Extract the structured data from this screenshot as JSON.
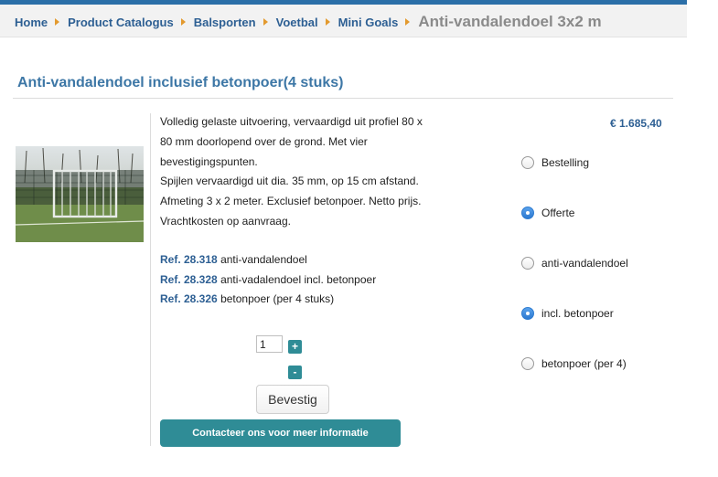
{
  "breadcrumb": {
    "items": [
      "Home",
      "Product Catalogus",
      "Balsporten",
      "Voetbal",
      "Mini Goals"
    ],
    "current": "Anti-vandalendoel 3x2 m"
  },
  "product": {
    "title": "Anti-vandalendoel inclusief betonpoer(4 stuks)",
    "description_lines": [
      "Volledig gelaste uitvoering, vervaardigd uit profiel 80 x",
      "80 mm doorlopend over de grond. Met vier",
      "bevestigingspunten.",
      "Spijlen vervaardigd uit dia. 35 mm, op 15 cm afstand.",
      "Afmeting 3 x 2 meter. Exclusief betonpoer. Netto prijs.",
      "Vrachtkosten op aanvraag."
    ],
    "refs": [
      {
        "label": "Ref. 28.318",
        "text": "anti-vandalendoel"
      },
      {
        "label": "Ref. 28.328",
        "text": "anti-vadalendoel incl. betonpoer"
      },
      {
        "label": "Ref. 28.326",
        "text": "betonpoer (per 4 stuks)"
      }
    ],
    "price": "€ 1.685,40",
    "image_icon": "football-goal-photo"
  },
  "options": [
    {
      "label": "Bestelling",
      "checked": false
    },
    {
      "label": "Offerte",
      "checked": true
    },
    {
      "label": "anti-vandalendoel",
      "checked": false
    },
    {
      "label": "incl. betonpoer",
      "checked": true
    },
    {
      "label": "betonpoer (per 4)",
      "checked": false
    }
  ],
  "quantity": {
    "value": "1",
    "plus_label": "+",
    "minus_label": "-"
  },
  "buttons": {
    "confirm_label": "Bevestig",
    "contact_label": "Contacteer ons voor meer informatie"
  },
  "colors": {
    "link": "#2d5f93",
    "title": "#3d77a6",
    "accent": "#2f8c96",
    "breadcrumb_arrow": "#e39a2e",
    "radio_checked": "#2d79d0"
  }
}
